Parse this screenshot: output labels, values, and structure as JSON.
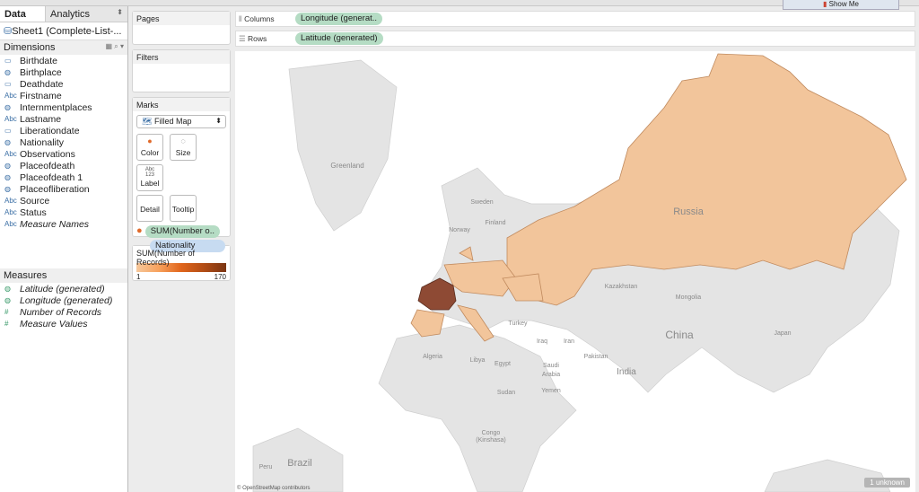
{
  "toolbar": {
    "show_me": "Show Me"
  },
  "data_pane": {
    "tabs": [
      "Data",
      "Analytics"
    ],
    "source": "Sheet1 (Complete-List-...",
    "dimensions_label": "Dimensions",
    "dimensions": [
      {
        "icon": "calendar-icon",
        "label": "Birthdate"
      },
      {
        "icon": "globe-icon",
        "label": "Birthplace"
      },
      {
        "icon": "calendar-icon",
        "label": "Deathdate"
      },
      {
        "icon": "abc-icon",
        "label": "Firstname"
      },
      {
        "icon": "globe-icon",
        "label": "Internmentplaces"
      },
      {
        "icon": "abc-icon",
        "label": "Lastname"
      },
      {
        "icon": "calendar-icon",
        "label": "Liberationdate"
      },
      {
        "icon": "globe-icon",
        "label": "Nationality"
      },
      {
        "icon": "abc-icon",
        "label": "Observations"
      },
      {
        "icon": "globe-icon",
        "label": "Placeofdeath"
      },
      {
        "icon": "globe-icon",
        "label": "Placeofdeath 1"
      },
      {
        "icon": "globe-icon",
        "label": "Placeofliberation"
      },
      {
        "icon": "abc-icon",
        "label": "Source"
      },
      {
        "icon": "abc-icon",
        "label": "Status"
      },
      {
        "icon": "abc-icon",
        "label": "Measure Names"
      }
    ],
    "measures_label": "Measures",
    "measures": [
      {
        "icon": "globe-icon",
        "label": "Latitude (generated)"
      },
      {
        "icon": "globe-icon",
        "label": "Longitude (generated)"
      },
      {
        "icon": "hash-icon",
        "label": "Number of Records"
      },
      {
        "icon": "hash-icon",
        "label": "Measure Values"
      }
    ]
  },
  "cards": {
    "pages": "Pages",
    "filters": "Filters",
    "marks": "Marks",
    "mark_type": "Filled Map",
    "buttons": [
      "Color",
      "Size",
      "Label",
      "Detail",
      "Tooltip"
    ],
    "pills": [
      "SUM(Number o..",
      "Nationality"
    ],
    "legend_title": "SUM(Number of Records)",
    "legend_min": "1",
    "legend_max": "170"
  },
  "shelves": {
    "columns_label": "Columns",
    "columns_pill": "Longitude (generat..",
    "rows_label": "Rows",
    "rows_pill": "Latitude (generated)"
  },
  "map": {
    "labels": [
      "Greenland",
      "Sweden",
      "Finland",
      "Norway",
      "Russia",
      "Kazakhstan",
      "Mongolia",
      "China",
      "Japan",
      "Turkey",
      "Iraq",
      "Iran",
      "Pakistan",
      "India",
      "Algeria",
      "Libya",
      "Egypt",
      "Saudi",
      "Arabia",
      "Yemen",
      "Sudan",
      "Congo",
      "(Kinshasa)",
      "Peru",
      "Brazil"
    ],
    "attribution": "© OpenStreetMap contributors",
    "unknown": "1 unknown",
    "colors": {
      "low": "#f2c59b",
      "high": "#8e4a34",
      "land": "#e4e4e4"
    }
  }
}
